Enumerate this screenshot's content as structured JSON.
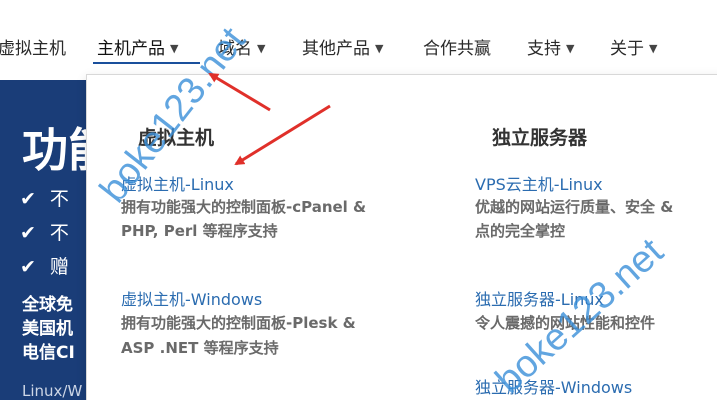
{
  "nav": {
    "items": [
      {
        "label": "虚拟主机",
        "caret": ""
      },
      {
        "label": "主机产品",
        "caret": "▼"
      },
      {
        "label": "域名",
        "caret": "▼"
      },
      {
        "label": "其他产品",
        "caret": "▼"
      },
      {
        "label": "合作共赢",
        "caret": ""
      },
      {
        "label": "支持",
        "caret": "▼"
      },
      {
        "label": "关于",
        "caret": "▼"
      }
    ]
  },
  "hero": {
    "title": "功能",
    "features": [
      "✔",
      "不",
      "✔",
      "不",
      "✔",
      "赠"
    ],
    "line1": "全球免",
    "line2": "美国机",
    "line3": "电信CI",
    "small": "Linux/W"
  },
  "dropdown": {
    "col1_title": "虚拟主机",
    "col2_title": "独立服务器",
    "col1_items": [
      {
        "title": "虚拟主机-Linux",
        "desc_line1": "拥有功能强大的控制面板-cPanel &",
        "desc_line2": "PHP, Perl 等程序支持"
      },
      {
        "title": "虚拟主机-Windows",
        "desc_line1": "拥有功能强大的控制面板-Plesk &",
        "desc_line2": "ASP .NET 等程序支持"
      }
    ],
    "col2_items": [
      {
        "title": "VPS云主机-Linux",
        "desc_line1": "优越的网站运行质量、安全 &",
        "desc_line2": "点的完全掌控"
      },
      {
        "title": "独立服务器-Linux",
        "desc_line1": "令人震撼的网站性能和控件",
        "desc_line2": ""
      },
      {
        "title": "独立服务器-Windows",
        "desc_line1": "",
        "desc_line2": ""
      }
    ]
  },
  "watermark": {
    "text1": "boke123.net",
    "text2": "boke123.net",
    "color": "#3a8fd8"
  },
  "colors": {
    "link": "#2b6cb0",
    "hero_bg": "#1a3d78",
    "arrow": "#e0302a"
  }
}
